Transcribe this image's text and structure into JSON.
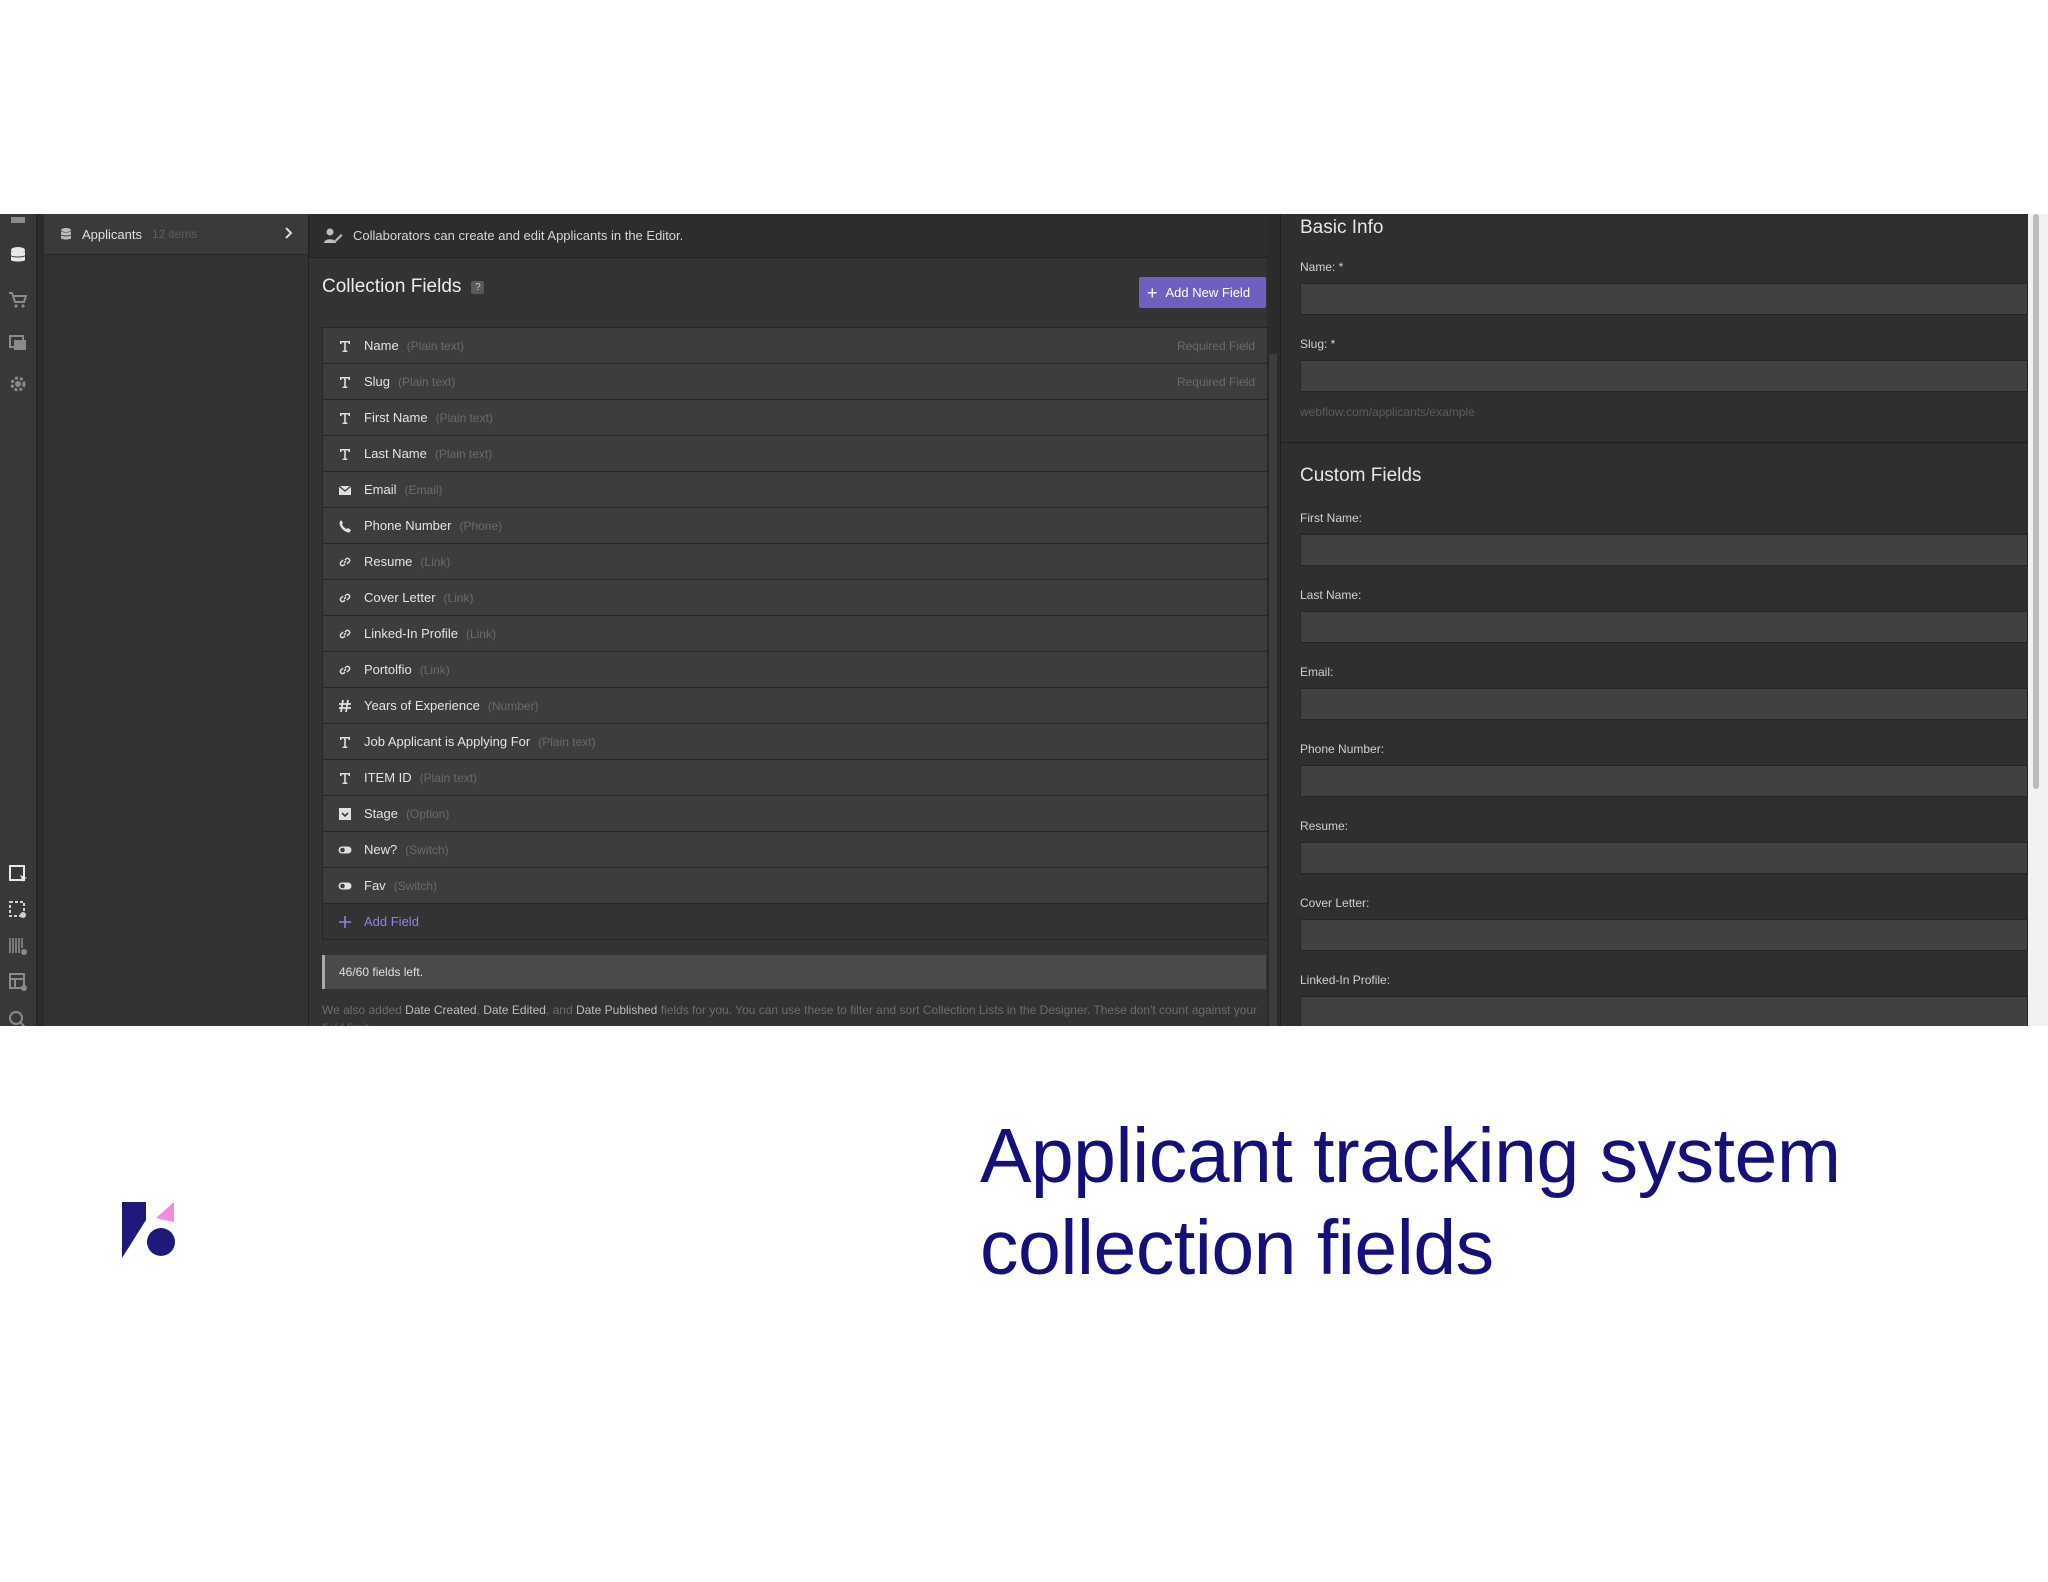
{
  "sidebar": {
    "collection": {
      "name": "Applicants",
      "count": "12 items"
    }
  },
  "notice": {
    "text": "Collaborators can create and edit Applicants in the Editor."
  },
  "collection_fields": {
    "title": "Collection Fields",
    "help": "?",
    "add_new_label": "Add New Field",
    "fields": [
      {
        "name": "Name",
        "type": "(Plain text)",
        "icon": "text-icon",
        "required": "Required Field"
      },
      {
        "name": "Slug",
        "type": "(Plain text)",
        "icon": "text-icon",
        "required": "Required Field"
      },
      {
        "name": "First Name",
        "type": "(Plain text)",
        "icon": "text-icon",
        "required": ""
      },
      {
        "name": "Last Name",
        "type": "(Plain text)",
        "icon": "text-icon",
        "required": ""
      },
      {
        "name": "Email",
        "type": "(Email)",
        "icon": "email-icon",
        "required": ""
      },
      {
        "name": "Phone Number",
        "type": "(Phone)",
        "icon": "phone-icon",
        "required": ""
      },
      {
        "name": "Resume",
        "type": "(Link)",
        "icon": "link-icon",
        "required": ""
      },
      {
        "name": "Cover Letter",
        "type": "(Link)",
        "icon": "link-icon",
        "required": ""
      },
      {
        "name": "Linked-In Profile",
        "type": "(Link)",
        "icon": "link-icon",
        "required": ""
      },
      {
        "name": "Portolfio",
        "type": "(Link)",
        "icon": "link-icon",
        "required": ""
      },
      {
        "name": "Years of Experience",
        "type": "(Number)",
        "icon": "number-icon",
        "required": ""
      },
      {
        "name": "Job Applicant is Applying For",
        "type": "(Plain text)",
        "icon": "text-icon",
        "required": ""
      },
      {
        "name": "ITEM ID",
        "type": "(Plain text)",
        "icon": "text-icon",
        "required": ""
      },
      {
        "name": "Stage",
        "type": "(Option)",
        "icon": "option-icon",
        "required": ""
      },
      {
        "name": "New?",
        "type": "(Switch)",
        "icon": "switch-icon",
        "required": ""
      },
      {
        "name": "Fav",
        "type": "(Switch)",
        "icon": "switch-icon",
        "required": ""
      }
    ],
    "add_field_label": "Add Field",
    "fields_left": "46/60 fields left.",
    "footnote": {
      "pre": "We also added ",
      "date_created": "Date Created",
      "sep1": ", ",
      "date_edited": "Date Edited",
      "sep2": ", and ",
      "date_published": "Date Published",
      "post": " fields for you. You can use these to filter and sort Collection Lists in the Designer. These don't count against your field limit."
    }
  },
  "basic_info": {
    "title": "Basic Info",
    "name_label": "Name: *",
    "slug_label": "Slug: *",
    "slug_hint": "webflow.com/applicants/example"
  },
  "custom_fields": {
    "title": "Custom Fields",
    "labels": [
      "First Name:",
      "Last Name:",
      "Email:",
      "Phone Number:",
      "Resume:",
      "Cover Letter:",
      "Linked-In Profile:"
    ]
  },
  "caption": {
    "line1": "Applicant tracking system",
    "line2": "collection fields"
  },
  "colors": {
    "accent": "#6f5fbf",
    "caption": "#150f7a",
    "logo_dark": "#1f1a7a",
    "logo_pink": "#f28ce0"
  }
}
